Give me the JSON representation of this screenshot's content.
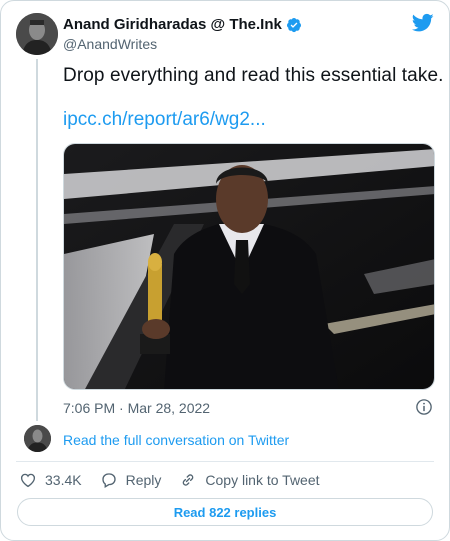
{
  "author": {
    "display_name": "Anand Giridharadas @ The.Ink",
    "handle": "@AnandWrites"
  },
  "tweet": {
    "text": "Drop everything and read this essential take.",
    "link": "ipcc.ch/report/ar6/wg2...",
    "timestamp": "7:06 PM · Mar 28, 2022"
  },
  "conversation": {
    "link_label": "Read the full conversation on Twitter"
  },
  "actions": {
    "like_count": "33.4K",
    "reply_label": "Reply",
    "copy_label": "Copy link to Tweet"
  },
  "replies_button": "Read 822 replies",
  "colors": {
    "accent": "#1d9bf0",
    "text": "#0f1419",
    "secondary": "#536471",
    "border": "#cfd9de"
  },
  "icons": [
    "verified-badge-icon",
    "twitter-bird-icon",
    "info-icon",
    "heart-icon",
    "reply-icon",
    "link-icon"
  ]
}
